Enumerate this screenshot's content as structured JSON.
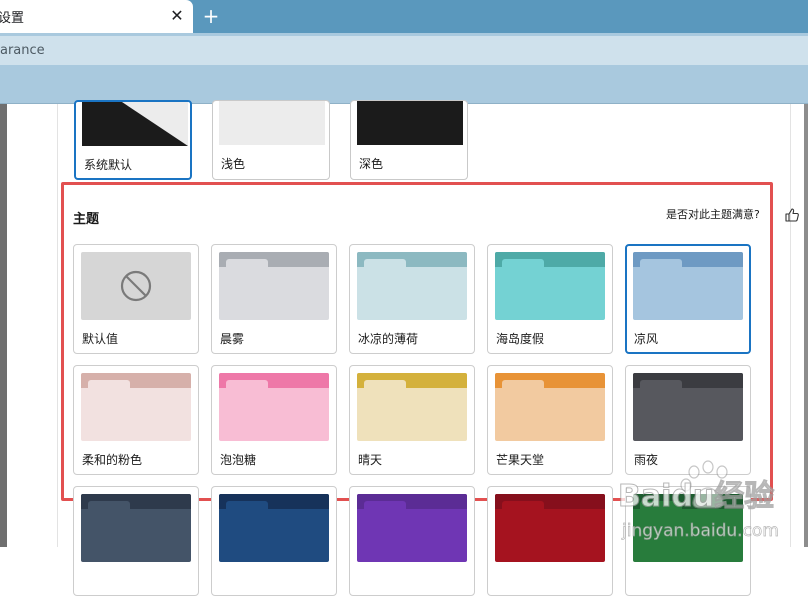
{
  "browser": {
    "tab_title": "设置",
    "url_text": "arance"
  },
  "appearance": {
    "options": [
      {
        "label": "系统默认",
        "selected": true
      },
      {
        "label": "浅色",
        "selected": false
      },
      {
        "label": "深色",
        "selected": false
      }
    ],
    "colors": {
      "dark": "#1b1b1b",
      "light": "#ececec",
      "split_light": "#ececec"
    }
  },
  "themes": {
    "title": "主题",
    "feedback_text": "是否对此主题满意?",
    "feedback_icon": "thumbs-up-icon",
    "default_icon": "ban-icon",
    "items": [
      {
        "label": "默认值",
        "top": "#d6d6d6",
        "body": "#d6d6d6",
        "tab": "#d6d6d6",
        "is_default": true
      },
      {
        "label": "晨雾",
        "top": "#a9adb3",
        "body": "#dadbdf",
        "tab": "#dadbdf"
      },
      {
        "label": "冰凉的薄荷",
        "top": "#8cb9c1",
        "body": "#cbe1e6",
        "tab": "#cbe1e6"
      },
      {
        "label": "海岛度假",
        "top": "#4eaaa7",
        "body": "#74d2d3",
        "tab": "#74d2d3"
      },
      {
        "label": "凉风",
        "top": "#6e9ac3",
        "body": "#a5c5df",
        "tab": "#a5c5df",
        "selected": true
      },
      {
        "label": "柔和的粉色",
        "top": "#d6b0aa",
        "body": "#f2e1e0",
        "tab": "#f2e1e0"
      },
      {
        "label": "泡泡糖",
        "top": "#ee78a8",
        "body": "#f8bdd4",
        "tab": "#f8bdd4"
      },
      {
        "label": "晴天",
        "top": "#d4b13c",
        "body": "#efe1bb",
        "tab": "#efe1bb"
      },
      {
        "label": "芒果天堂",
        "top": "#e89337",
        "body": "#f2caa0",
        "tab": "#f2caa0"
      },
      {
        "label": "雨夜",
        "top": "#3b3c41",
        "body": "#57585e",
        "tab": "#57585e"
      },
      {
        "label": "",
        "top": "#2e3a4c",
        "body": "#445468",
        "tab": "#445468"
      },
      {
        "label": "",
        "top": "#16325a",
        "body": "#1f4b80",
        "tab": "#1f4b80"
      },
      {
        "label": "",
        "top": "#5b2c95",
        "body": "#6f36b4",
        "tab": "#6f36b4"
      },
      {
        "label": "",
        "top": "#860f1c",
        "body": "#a5131f",
        "tab": "#a5131f"
      },
      {
        "label": "",
        "top": "#1d5b2f",
        "body": "#287c3c",
        "tab": "#287c3c"
      }
    ]
  },
  "watermark": {
    "brand": "Baidu经验",
    "site": "jingyan.baidu.com"
  }
}
